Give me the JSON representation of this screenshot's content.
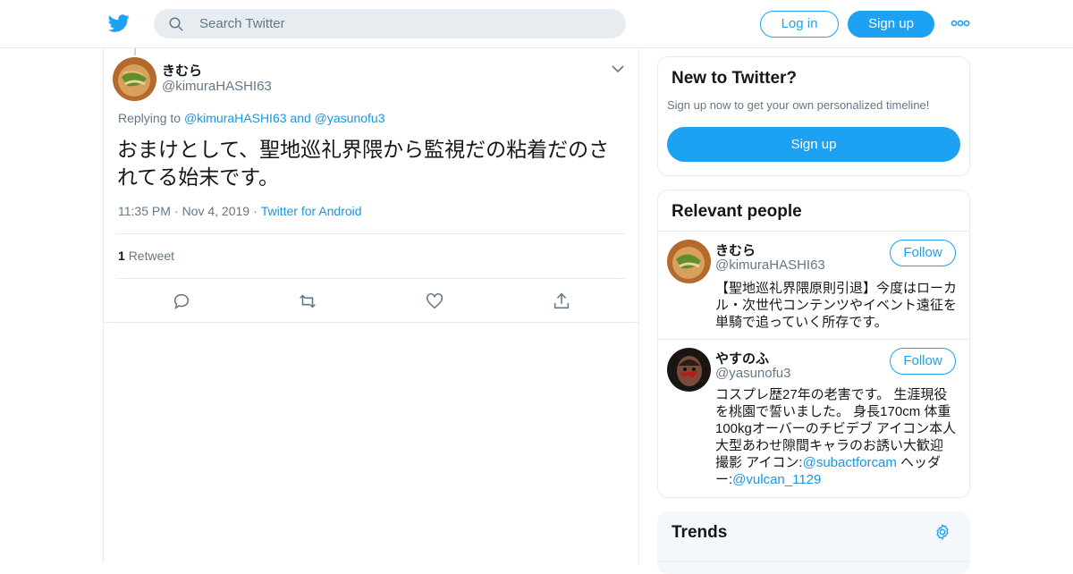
{
  "colors": {
    "brand": "#1da1f2",
    "link": "#1b95e0",
    "muted": "#657786",
    "text": "#14171a"
  },
  "header": {
    "logo_icon": "twitter-bird-icon",
    "search_placeholder": "Search Twitter",
    "login_label": "Log in",
    "signup_label": "Sign up",
    "more_icon": "more-dots-icon"
  },
  "tweet": {
    "author_name": "きむら",
    "author_handle": "@kimuraHASHI63",
    "replying_prefix": "Replying to",
    "replying_user1": "@kimuraHASHI63",
    "replying_and": "and",
    "replying_user2": "@yasunofu3",
    "text": "おまけとして、聖地巡礼界隈から監視だの粘着だのされてる始末です。",
    "time": "11:35 PM",
    "date": "Nov 4, 2019",
    "source": "Twitter for Android",
    "retweet_count": "1",
    "retweet_label": "Retweet"
  },
  "sidebar": {
    "new_title": "New to Twitter?",
    "new_sub": "Sign up now to get your own personalized timeline!",
    "new_signup": "Sign up",
    "relevant_title": "Relevant people",
    "people": [
      {
        "name": "きむら",
        "handle": "@kimuraHASHI63",
        "follow": "Follow",
        "bio": "【聖地巡礼界隈原則引退】今度はローカル・次世代コンテンツやイベント遠征を単騎で追っていく所存です。"
      },
      {
        "name": "やすのふ",
        "handle": "@yasunofu3",
        "follow": "Follow",
        "bio_text": "コスプレ歴27年の老害です。 生涯現役を桃園で誓いました。 身長170cm 体重100kgオーバーのチビデブ アイコン本人 大型あわせ隙間キャラのお誘い大歓迎 撮影 アイコン:",
        "bio_link1": "@subactforcam",
        "bio_mid": " ヘッダー:",
        "bio_link2": "@vulcan_1129"
      }
    ],
    "trends_title": "Trends"
  }
}
